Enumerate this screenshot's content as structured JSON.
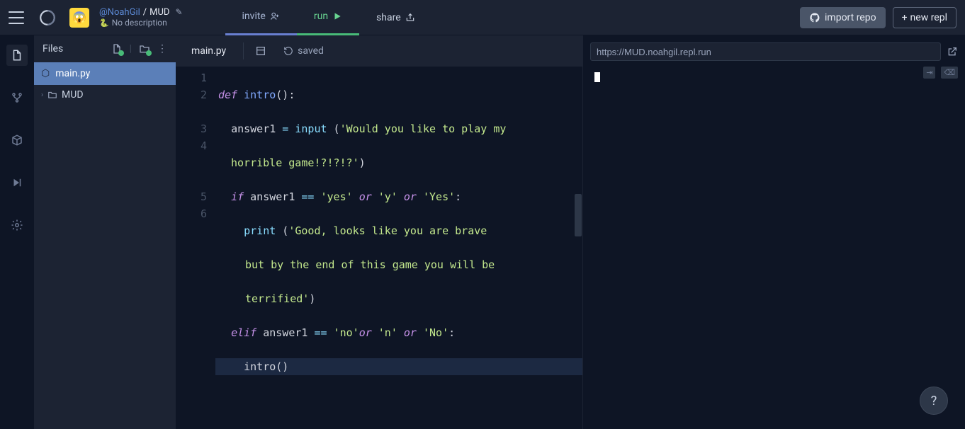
{
  "header": {
    "user": "@NoahGil",
    "separator": "/",
    "project": "MUD",
    "lang_desc": "No description"
  },
  "topButtons": {
    "invite": "invite",
    "run": "run",
    "share": "share",
    "import_repo": "import repo",
    "new_repl": "new repl"
  },
  "files": {
    "title": "Files",
    "active_file": "main.py",
    "folder": "MUD"
  },
  "editor": {
    "tab": "main.py",
    "saved": "saved",
    "gutter": [
      "1",
      "2",
      "3",
      "4",
      "5",
      "6"
    ]
  },
  "code": {
    "l1_def": "def",
    "l1_fn": "intro",
    "l1_rest": "():",
    "l2_var": "answer1",
    "l2_eq": " = ",
    "l2_input": "input",
    "l2_p1": " (",
    "l2_str": "'Would you like to play my ",
    "l2b_str": "horrible game!?!?!?'",
    "l2_p2": ")",
    "l3_if": "if",
    "l3_var": " answer1 ",
    "l3_eqeq": "==",
    "l3_s1": " 'yes' ",
    "l3_or1": "or",
    "l3_s2": " 'y' ",
    "l3_or2": "or",
    "l3_s3": " 'Yes'",
    "l3_colon": ":",
    "l4_print": "print",
    "l4_p1": " (",
    "l4_str": "'Good, looks like you are brave ",
    "l4b_str": "but by the end of this game you will be ",
    "l4c_str": "terrified'",
    "l4_p2": ")",
    "l5_elif": "elif",
    "l5_var": " answer1 ",
    "l5_eqeq": "==",
    "l5_s1": " 'no'",
    "l5_or1": "or",
    "l5_s2": " 'n' ",
    "l5_or2": "or",
    "l5_s3": " 'No'",
    "l5_colon": ":",
    "l6_fn": "intro",
    "l6_rest": "()"
  },
  "output": {
    "url": "https://MUD.noahgil.repl.run",
    "prompt": ""
  },
  "help": "?"
}
